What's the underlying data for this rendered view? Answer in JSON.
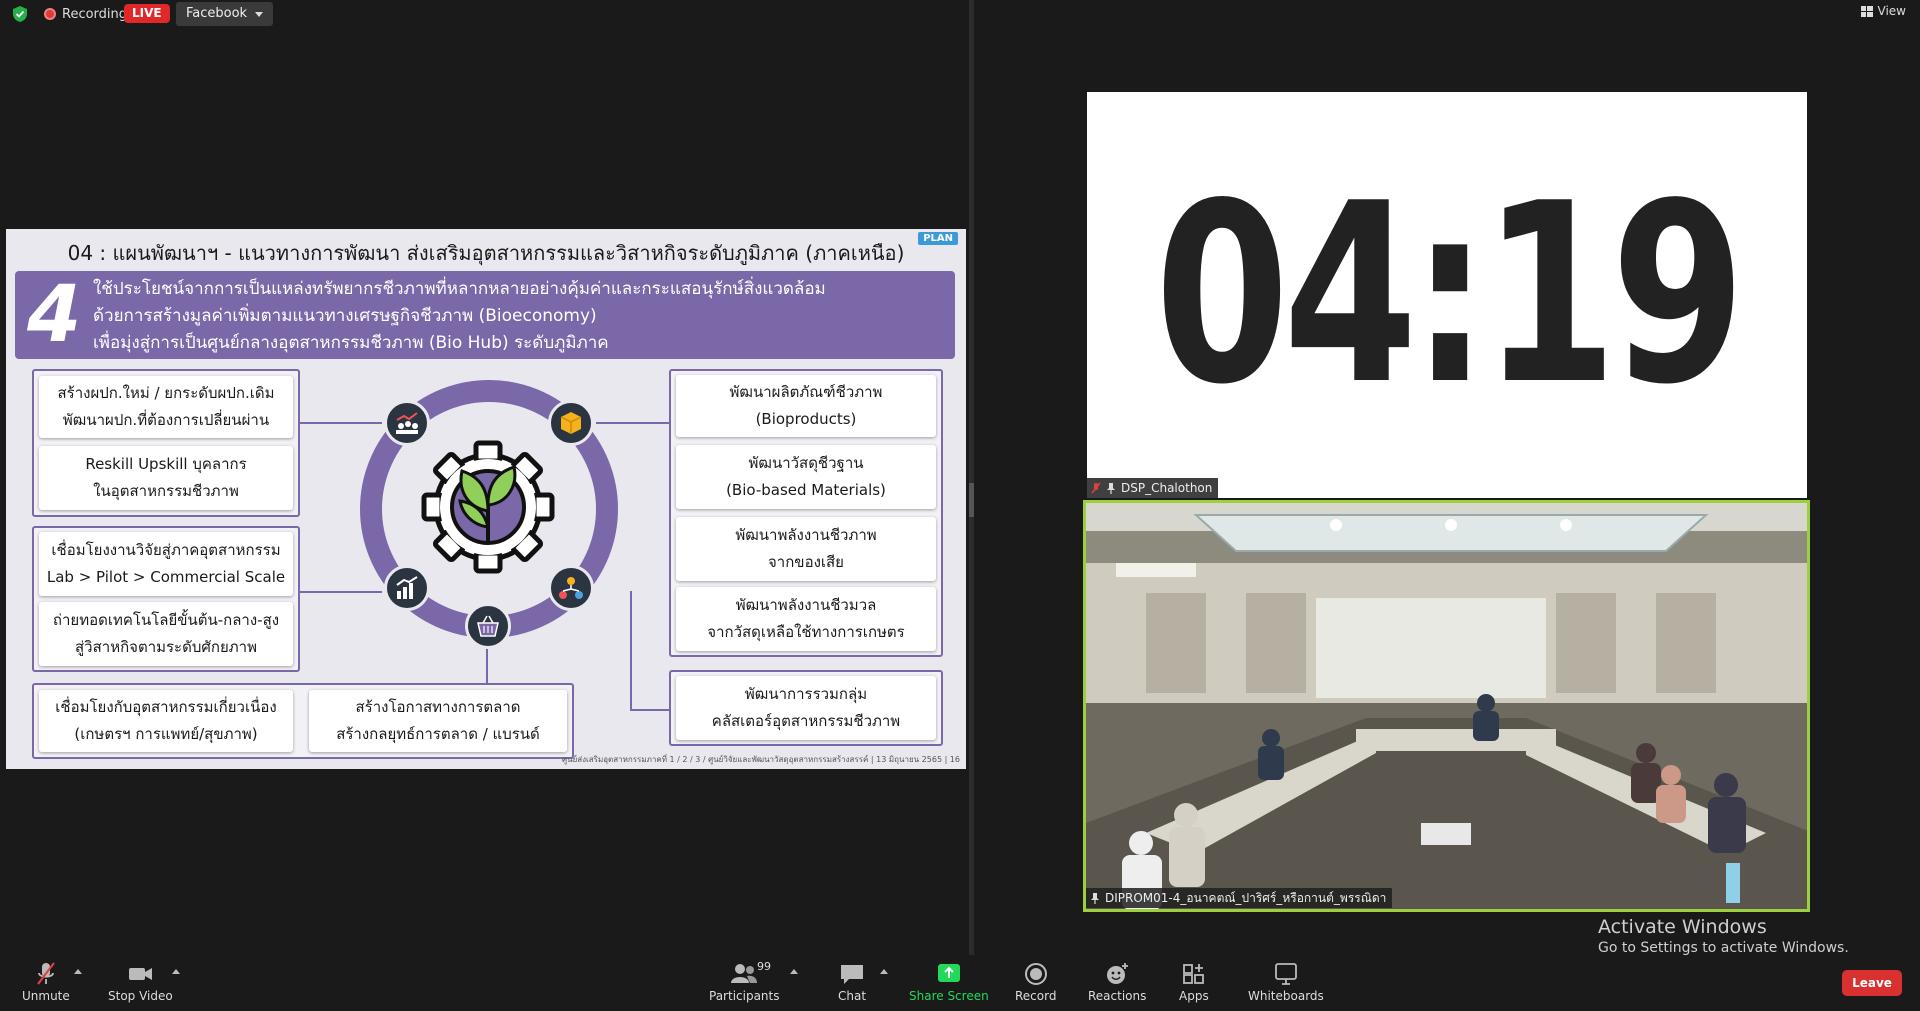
{
  "topbar": {
    "recording_label": "Recording",
    "live_label": "LIVE",
    "stream_target": "Facebook",
    "view_label": "View"
  },
  "slide": {
    "title": "04 : แผนพัฒนาฯ - แนวทางการพัฒนา ส่งเสริมอุตสาหกรรมและวิสาหกิจระดับภูมิภาค (ภาคเหนือ)",
    "badge": "PLAN",
    "number": "4",
    "header_lines": [
      "ใช้ประโยชน์จากการเป็นแหล่งทรัพยากรชีวภาพที่หลากหลายอย่างคุ้มค่าและกระแสอนุรักษ์สิ่งแวดล้อม",
      "ด้วยการสร้างมูลค่าเพิ่มตามแนวทางเศรษฐกิจชีวภาพ (Bioeconomy)",
      "เพื่อมุ่งสู่การเป็นศูนย์กลางอุตสาหกรรมชีวภาพ (Bio Hub) ระดับภูมิภาค"
    ],
    "left_cards": [
      {
        "l1": "สร้างผปก.ใหม่ / ยกระดับผปก.เดิม",
        "l2": "พัฒนาผปก.ที่ต้องการเปลี่ยนผ่าน"
      },
      {
        "l1": "Reskill Upskill บุคลากร",
        "l2": "ในอุตสาหกรรมชีวภาพ"
      },
      {
        "l1": "เชื่อมโยงงานวิจัยสู่ภาคอุตสาหกรรม",
        "l2": "Lab > Pilot > Commercial Scale"
      },
      {
        "l1": "ถ่ายทอดเทคโนโลยีขั้นต้น-กลาง-สูง",
        "l2": "สู่วิสาหกิจตามระดับศักยภาพ"
      }
    ],
    "bottom_cards": [
      {
        "l1": "เชื่อมโยงกับอุตสาหกรรมเกี่ยวเนื่อง",
        "l2": "(เกษตรฯ การแพทย์/สุขภาพ)"
      },
      {
        "l1": "สร้างโอกาสทางการตลาด",
        "l2": "สร้างกลยุทธ์การตลาด / แบรนด์"
      }
    ],
    "right_cards": [
      {
        "l1": "พัฒนาผลิตภัณฑ์ชีวภาพ",
        "l2": "(Bioproducts)"
      },
      {
        "l1": "พัฒนาวัสดุชีวฐาน",
        "l2": "(Bio-based Materials)"
      },
      {
        "l1": "พัฒนาพลังงานชีวภาพ",
        "l2": "จากของเสีย"
      },
      {
        "l1": "พัฒนาพลังงานชีวมวล",
        "l2": "จากวัสดุเหลือใช้ทางการเกษตร"
      },
      {
        "l1": "พัฒนาการรวมกลุ่ม",
        "l2": "คลัสเตอร์อุตสาหกรรมชีวภาพ"
      }
    ],
    "footer": "ศูนย์ส่งเสริมอุตสาหกรรมภาคที่ 1 / 2 / 3 / ศูนย์วิจัยและพัฒนาวัสดุอุตสาหกรรมสร้างสรรค์ | 13 มิถุนายน 2565 | 16"
  },
  "timer": {
    "value": "04:19",
    "participant_name": "DSP_Chalothon"
  },
  "video": {
    "participant_name": "DIPROM01-4_อนาคตณ์_ปาริศร์_หรือกานต์_พรรณิดา"
  },
  "watermark": {
    "line1": "Activate Windows",
    "line2": "Go to Settings to activate Windows."
  },
  "toolbar": {
    "unmute": "Unmute",
    "stop_video": "Stop Video",
    "participants": "Participants",
    "participant_count": "99",
    "chat": "Chat",
    "share_screen": "Share Screen",
    "record": "Record",
    "reactions": "Reactions",
    "apps": "Apps",
    "whiteboards": "Whiteboards",
    "leave": "Leave"
  },
  "colors": {
    "accent_purple": "#7b68a8",
    "share_green": "#23d959",
    "active_speaker_border": "#9bd13c",
    "leave_red": "#d93030"
  }
}
